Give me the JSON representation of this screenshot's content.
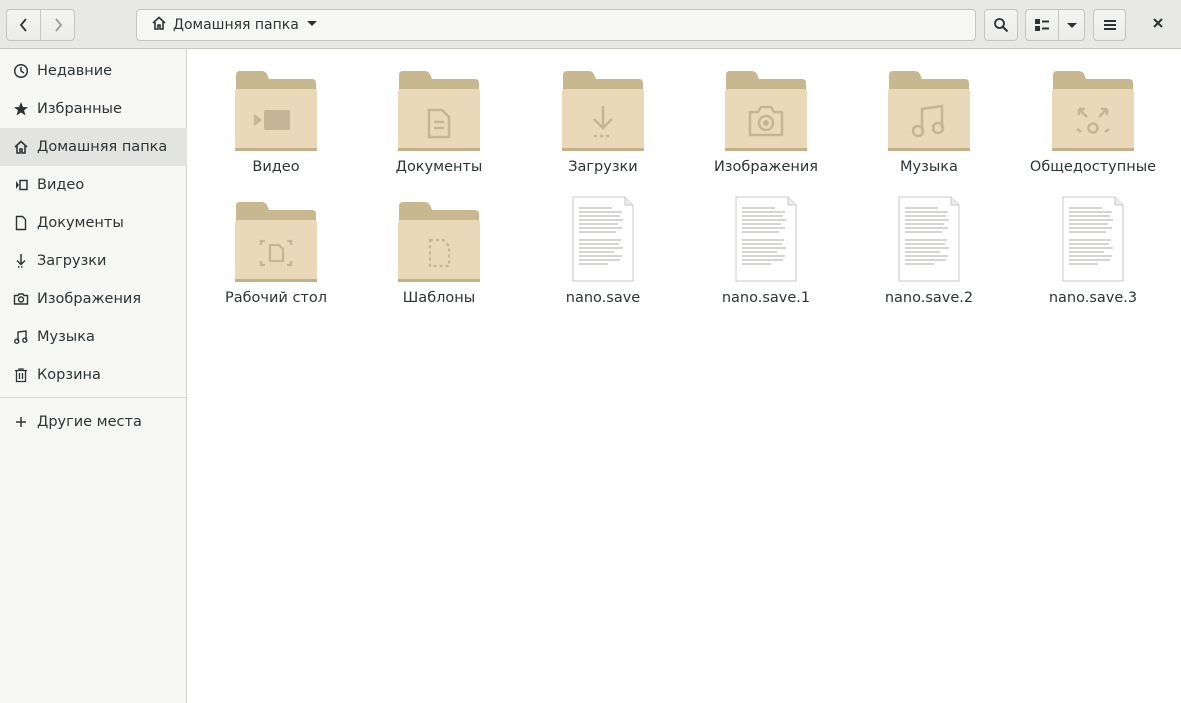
{
  "header": {
    "back_icon": "go-previous-icon",
    "forward_icon": "go-next-icon",
    "path": {
      "home_icon": "home-icon",
      "label": "Домашняя папка",
      "dropdown_icon": "pan-down-icon"
    },
    "search_icon": "search-icon",
    "view_icon": "list-view-icon",
    "view_dropdown_icon": "pan-down-icon",
    "menu_icon": "hamburger-menu-icon",
    "close_icon": "close-icon"
  },
  "sidebar": {
    "items": [
      {
        "label": "Недавние",
        "icon": "clock-icon"
      },
      {
        "label": "Избранные",
        "icon": "star-icon"
      },
      {
        "label": "Домашняя папка",
        "icon": "home-icon",
        "active": true
      },
      {
        "label": "Видео",
        "icon": "video-icon"
      },
      {
        "label": "Документы",
        "icon": "document-icon"
      },
      {
        "label": "Загрузки",
        "icon": "download-icon"
      },
      {
        "label": "Изображения",
        "icon": "camera-icon"
      },
      {
        "label": "Музыка",
        "icon": "music-icon"
      },
      {
        "label": "Корзина",
        "icon": "trash-icon"
      }
    ],
    "other_places": {
      "label": "Другие места",
      "icon": "plus-icon"
    }
  },
  "files": [
    {
      "name": "Видео",
      "kind": "folder",
      "emblem": "video"
    },
    {
      "name": "Документы",
      "kind": "folder",
      "emblem": "documents"
    },
    {
      "name": "Загрузки",
      "kind": "folder",
      "emblem": "download"
    },
    {
      "name": "Изображения",
      "kind": "folder",
      "emblem": "camera"
    },
    {
      "name": "Музыка",
      "kind": "folder",
      "emblem": "music"
    },
    {
      "name": "Общедоступные",
      "kind": "folder",
      "emblem": "share"
    },
    {
      "name": "Рабочий стол",
      "kind": "folder",
      "emblem": "desktop"
    },
    {
      "name": "Шаблоны",
      "kind": "folder",
      "emblem": "templates"
    },
    {
      "name": "nano.save",
      "kind": "text-file"
    },
    {
      "name": "nano.save.1",
      "kind": "text-file"
    },
    {
      "name": "nano.save.2",
      "kind": "text-file"
    },
    {
      "name": "nano.save.3",
      "kind": "text-file"
    }
  ],
  "colors": {
    "folder_back": "#c8b88f",
    "folder_front": "#e9d9b8",
    "emblem": "#c3b595",
    "header_bg": "#e8e8e7",
    "sidebar_bg": "#f6f6f5",
    "sidebar_active": "#e3e3e1"
  }
}
